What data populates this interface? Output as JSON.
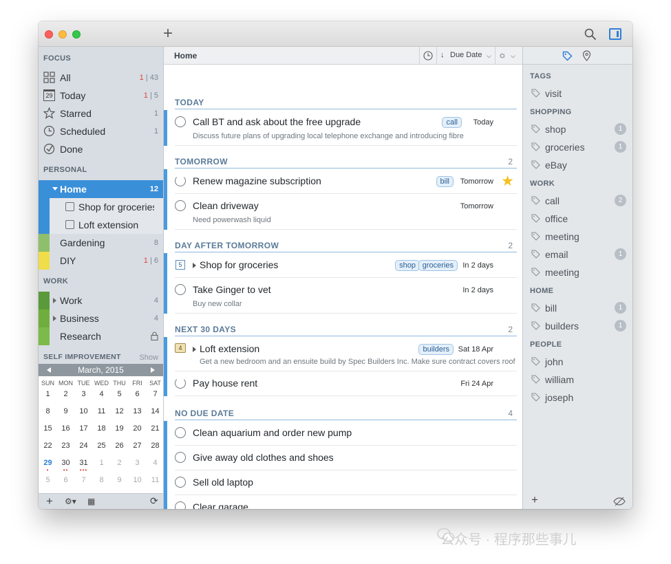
{
  "toolbar": {
    "add_label": "+"
  },
  "sidebar": {
    "focus_heading": "FOCUS",
    "focus_items": [
      {
        "label": "All",
        "count_red": "1",
        "count_rest": "43"
      },
      {
        "label": "Today",
        "count_red": "1",
        "count_rest": "5",
        "icon_text": "29"
      },
      {
        "label": "Starred",
        "count": "1"
      },
      {
        "label": "Scheduled",
        "count": "1"
      },
      {
        "label": "Done",
        "count": ""
      }
    ],
    "personal_heading": "PERSONAL",
    "home": {
      "label": "Home",
      "count": "12",
      "color": "#3a8fd9"
    },
    "home_children": [
      {
        "label": "Shop for groceries"
      },
      {
        "label": "Loft extension"
      }
    ],
    "personal_items": [
      {
        "label": "Gardening",
        "count": "8",
        "color": "#8fbf6a"
      },
      {
        "label": "DIY",
        "count_red": "1",
        "count_rest": "6",
        "color": "#f0dd4a"
      }
    ],
    "work_heading": "WORK",
    "work_items": [
      {
        "label": "Work",
        "count": "4",
        "color": "#5a9a3a"
      },
      {
        "label": "Business",
        "count": "4",
        "color": "#6fae3c"
      },
      {
        "label": "Research",
        "count": "",
        "color": "#7cbb4a"
      }
    ],
    "self_heading": "SELF IMPROVEMENT",
    "self_show": "Show",
    "calendar": {
      "title": "March, 2015",
      "dow": [
        "SUN",
        "MON",
        "TUE",
        "WED",
        "THU",
        "FRI",
        "SAT"
      ],
      "weeks": [
        [
          "1",
          "2",
          "3",
          "4",
          "5",
          "6",
          "7"
        ],
        [
          "8",
          "9",
          "10",
          "11",
          "12",
          "13",
          "14"
        ],
        [
          "15",
          "16",
          "17",
          "18",
          "19",
          "20",
          "21"
        ],
        [
          "22",
          "23",
          "24",
          "25",
          "26",
          "27",
          "28"
        ],
        [
          "29",
          "30",
          "31",
          "1",
          "2",
          "3",
          "4"
        ],
        [
          "5",
          "6",
          "7",
          "8",
          "9",
          "10",
          "11"
        ]
      ],
      "today": "29"
    }
  },
  "main": {
    "title": "Home",
    "sort_label": "Due Date",
    "groups": [
      {
        "title": "TODAY",
        "count": ""
      },
      {
        "title": "TOMORROW",
        "count": "2"
      },
      {
        "title": "DAY AFTER TOMORROW",
        "count": "2"
      },
      {
        "title": "NEXT 30 DAYS",
        "count": "2"
      },
      {
        "title": "NO DUE DATE",
        "count": "4"
      }
    ],
    "tasks": [
      {
        "title": "Call BT and ask about the free upgrade",
        "note": "Discuss future plans of upgrading local telephone exchange and introducing fibre",
        "tags": [
          "call"
        ],
        "due": "Today"
      },
      {
        "title": "Renew magazine subscription",
        "note": "",
        "tags": [
          "bill"
        ],
        "due": "Tomorrow"
      },
      {
        "title": "Clean driveway",
        "note": "Need powerwash liquid",
        "tags": [],
        "due": "Tomorrow"
      },
      {
        "title": "Shop for groceries",
        "note": "",
        "tags": [
          "shop",
          "groceries"
        ],
        "due": "In 2 days",
        "badge": "5"
      },
      {
        "title": "Take Ginger to vet",
        "note": "Buy new collar",
        "tags": [],
        "due": "In 2 days"
      },
      {
        "title": "Loft extension",
        "note": "Get a new bedroom and an ensuite build by Spec Builders Inc. Make sure contract covers roof",
        "tags": [
          "builders"
        ],
        "due": "Sat 18 Apr",
        "badge": "4"
      },
      {
        "title": "Pay house rent",
        "note": "",
        "tags": [],
        "due": "Fri 24 Apr"
      },
      {
        "title": "Clean aquarium and order new pump",
        "note": "",
        "tags": [],
        "due": ""
      },
      {
        "title": "Give away old clothes and shoes",
        "note": "",
        "tags": [],
        "due": ""
      },
      {
        "title": "Sell old laptop",
        "note": "",
        "tags": [],
        "due": ""
      },
      {
        "title": "Clear garage",
        "note": "",
        "tags": [],
        "due": ""
      }
    ]
  },
  "tags": {
    "sections": [
      {
        "heading": "TAGS",
        "items": [
          {
            "label": "visit",
            "count": ""
          }
        ]
      },
      {
        "heading": "SHOPPING",
        "items": [
          {
            "label": "shop",
            "count": "1"
          },
          {
            "label": "groceries",
            "count": "1"
          },
          {
            "label": "eBay",
            "count": ""
          }
        ]
      },
      {
        "heading": "WORK",
        "items": [
          {
            "label": "call",
            "count": "2"
          },
          {
            "label": "office",
            "count": ""
          },
          {
            "label": "meeting",
            "count": ""
          },
          {
            "label": "email",
            "count": "1"
          },
          {
            "label": "meeting",
            "count": ""
          }
        ]
      },
      {
        "heading": "HOME",
        "items": [
          {
            "label": "bill",
            "count": "1"
          },
          {
            "label": "builders",
            "count": "1"
          }
        ]
      },
      {
        "heading": "PEOPLE",
        "items": [
          {
            "label": "john",
            "count": ""
          },
          {
            "label": "william",
            "count": ""
          },
          {
            "label": "joseph",
            "count": ""
          }
        ]
      }
    ]
  },
  "watermark": "公众号 · 程序那些事儿",
  "colors": {
    "accent": "#3a8fd9",
    "star": "#f5c020",
    "overdue": "#e0403a"
  }
}
